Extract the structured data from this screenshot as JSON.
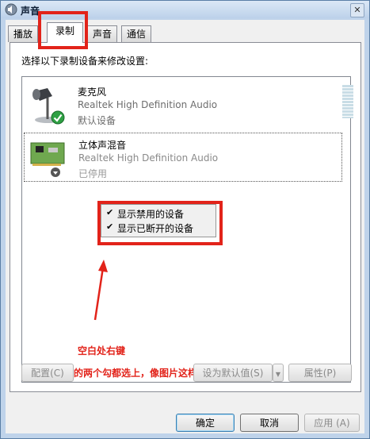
{
  "window": {
    "title": "声音"
  },
  "tabs": [
    {
      "label": "播放"
    },
    {
      "label": "录制"
    },
    {
      "label": "声音"
    },
    {
      "label": "通信"
    }
  ],
  "instructions": "选择以下录制设备来修改设置:",
  "devices": [
    {
      "name": "麦克风",
      "description": "Realtek High Definition Audio",
      "status": "默认设备"
    },
    {
      "name": "立体声混音",
      "description": "Realtek High Definition Audio",
      "status": "已停用"
    }
  ],
  "context_menu": {
    "items": [
      {
        "label": "显示禁用的设备",
        "checked": true
      },
      {
        "label": "显示已断开的设备",
        "checked": true
      }
    ]
  },
  "annotations": {
    "line1": "空白处右键",
    "line2": "将前面的两个勾都选上，像图片这样"
  },
  "panel_buttons": {
    "configure": "配置(C)",
    "set_default": "设为默认值(S)",
    "properties": "属性(P)"
  },
  "dialog_buttons": {
    "ok": "确定",
    "cancel": "取消",
    "apply": "应用 (A)"
  },
  "colors": {
    "annotation": "#e2231a",
    "titlebar": "#bcd1ea",
    "check_badge": "#2ea043"
  }
}
